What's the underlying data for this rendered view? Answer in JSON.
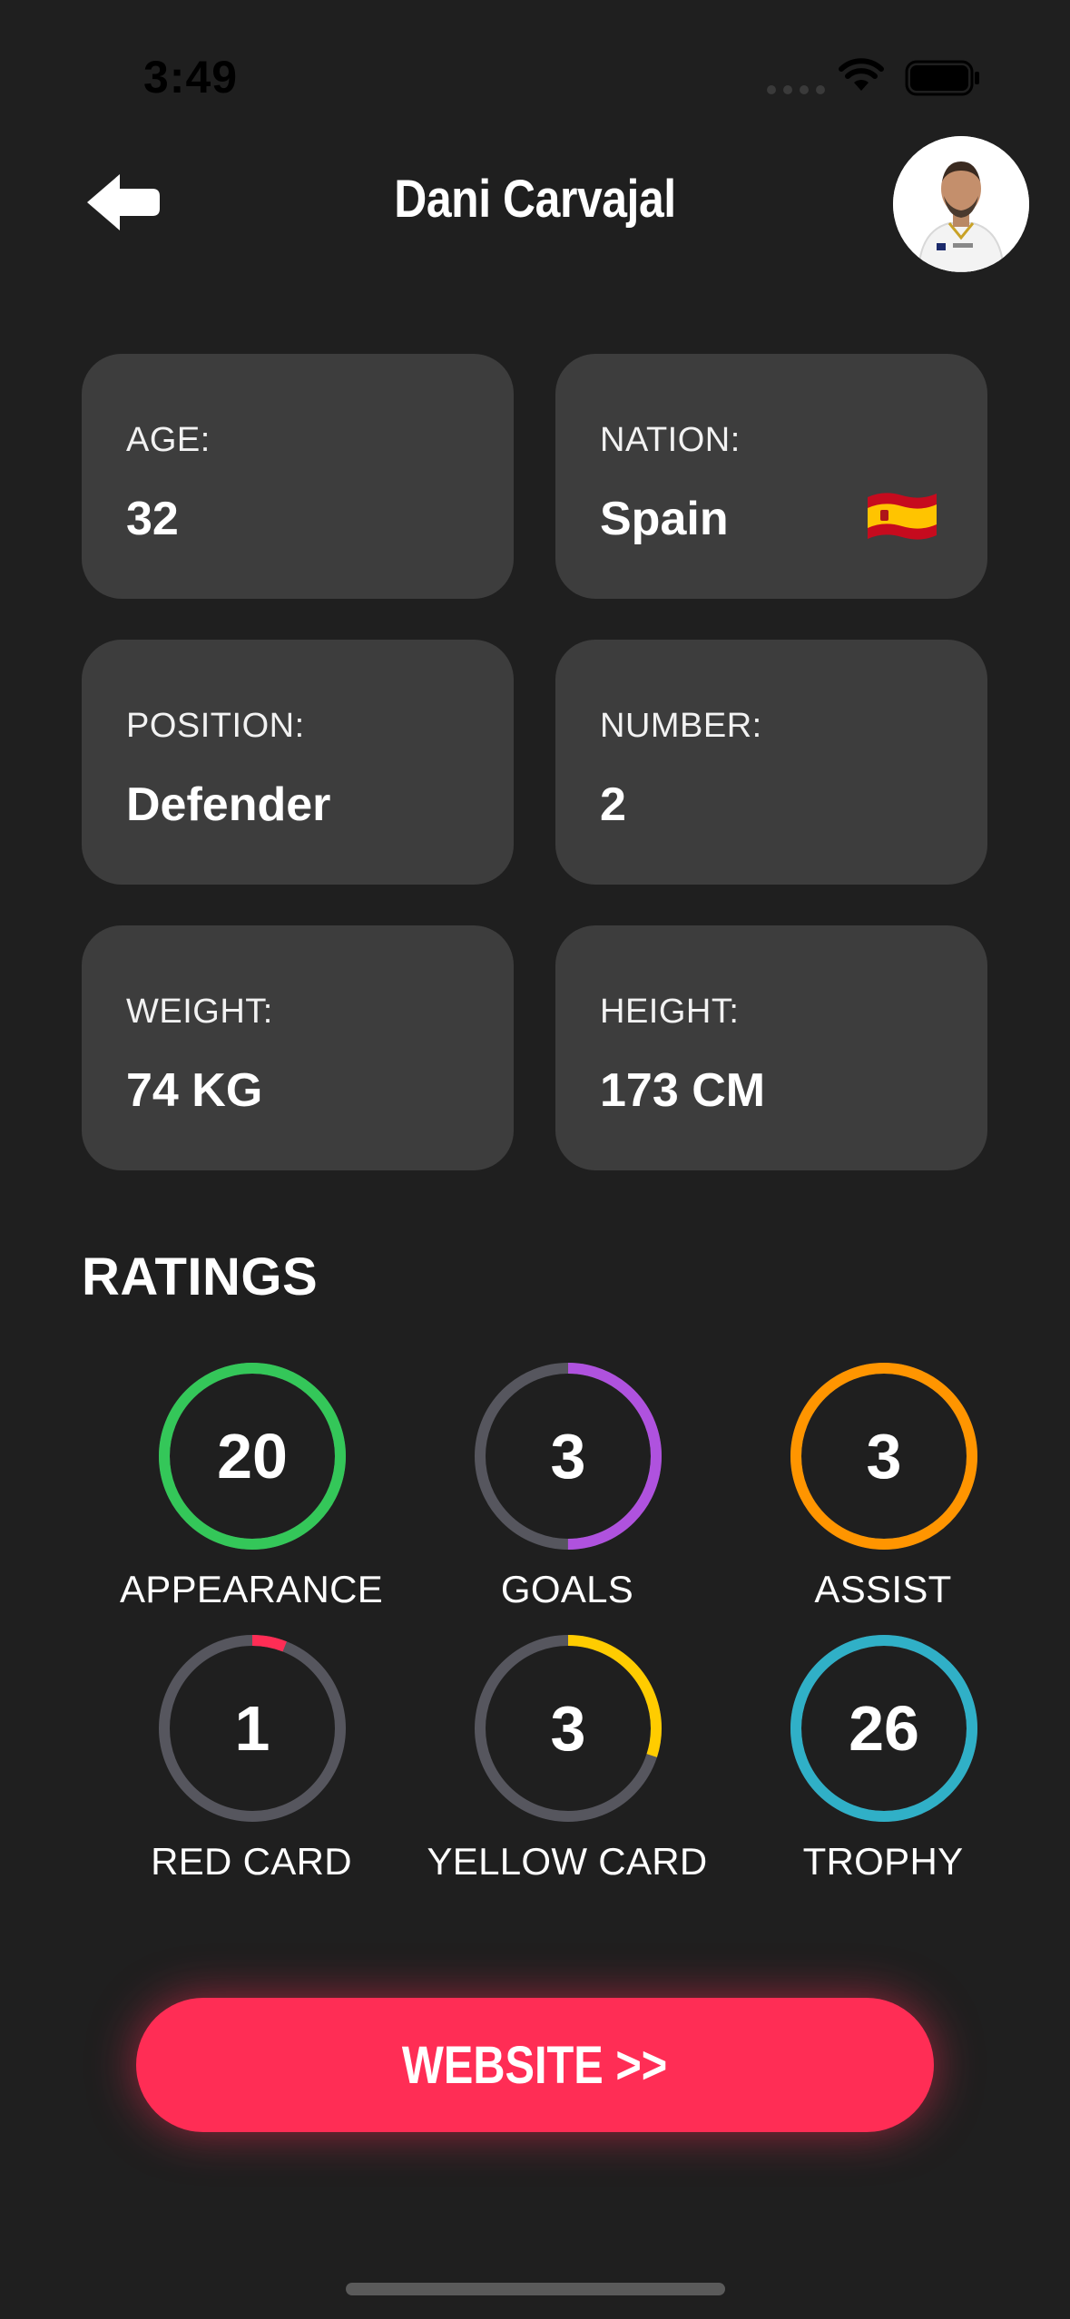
{
  "status_bar": {
    "time": "3:49"
  },
  "header": {
    "title": "Dani Carvajal",
    "back_icon": "arrow-left-icon",
    "avatar": "player-avatar"
  },
  "info_cards": [
    {
      "label": "AGE:",
      "value": "32"
    },
    {
      "label": "NATION:",
      "value": "Spain",
      "icon": "spain-flag-icon"
    },
    {
      "label": "POSITION:",
      "value": "Defender"
    },
    {
      "label": "NUMBER:",
      "value": "2"
    },
    {
      "label": "WEIGHT:",
      "value": "74 KG"
    },
    {
      "label": "HEIGHT:",
      "value": "173 CM"
    }
  ],
  "ratings": {
    "heading": "RATINGS",
    "items": [
      {
        "value": "20",
        "label": "APPEARANCE",
        "color": "#34c759",
        "progress": 1.0
      },
      {
        "value": "3",
        "label": "GOALS",
        "color": "#af52de",
        "progress": 0.5
      },
      {
        "value": "3",
        "label": "ASSIST",
        "color": "#ff9500",
        "progress": 1.0
      },
      {
        "value": "1",
        "label": "RED CARD",
        "color": "#ff2d55",
        "progress": 0.06
      },
      {
        "value": "3",
        "label": "YELLOW CARD",
        "color": "#ffcc00",
        "progress": 0.3
      },
      {
        "value": "26",
        "label": "TROPHY",
        "color": "#30b0c7",
        "progress": 1.0
      }
    ],
    "track_color": "#56565e"
  },
  "website_button": {
    "label": "WEBSITE >>",
    "color": "#ff2d55"
  }
}
